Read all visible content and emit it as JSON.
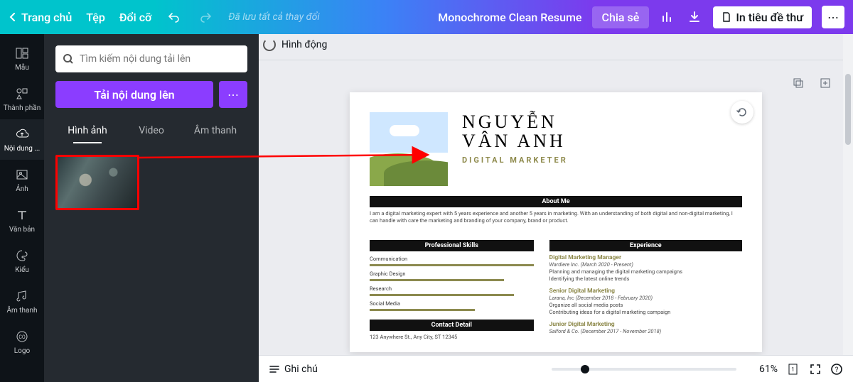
{
  "topbar": {
    "home": "Trang chủ",
    "file": "Tệp",
    "resize": "Đổi cỡ",
    "save_status": "Đã lưu tất cả thay đổi",
    "title": "Monochrome Clean Resume",
    "share": "Chia sẻ",
    "print": "In tiêu đề thư"
  },
  "rail": {
    "items": [
      {
        "label": "Mẫu"
      },
      {
        "label": "Thành phần"
      },
      {
        "label": "Nội dung ..."
      },
      {
        "label": "Ảnh"
      },
      {
        "label": "Văn bản"
      },
      {
        "label": "Kiểu"
      },
      {
        "label": "Âm thanh"
      },
      {
        "label": "Logo"
      }
    ]
  },
  "sidepanel": {
    "search_placeholder": "Tìm kiếm nội dung tải lên",
    "upload": "Tải nội dung lên",
    "tabs": [
      {
        "label": "Hình ảnh"
      },
      {
        "label": "Video"
      },
      {
        "label": "Âm thanh"
      }
    ]
  },
  "canvas": {
    "animate": "Hình động"
  },
  "resume": {
    "name_line1": "NGUYỄN",
    "name_line2": "VÂN ANH",
    "role": "DIGITAL MARKETER",
    "sec_about": "About Me",
    "about_text": "I am a digital marketing expert with 5 years experience and another 5 years in marketing. With an understanding of both digital and non-digital marketing, I can handle with care the marketing and branding of your company, brand or product.",
    "sec_skills": "Professional Skills",
    "sec_exp": "Experience",
    "skills": [
      "Communication",
      "Graphic Design",
      "Research",
      "Social Media"
    ],
    "sec_contact": "Contact Detail",
    "contact_addr": "123 Anywhere St., Any City, ST 12345",
    "jobs": [
      {
        "title": "Digital Marketing Manager",
        "meta": "Wardiere Inc. (March 2020 - Present)",
        "lines": [
          "Planning and managing the digital marketing campaigns",
          "Identifying the latest online trends"
        ]
      },
      {
        "title": "Senior Digital Marketing",
        "meta": "Larana, Inc (December 2018 - February 2020)",
        "lines": [
          "Organize all social media posts",
          "Contributing ideas for a digital marketing campaign"
        ]
      },
      {
        "title": "Junior Digital Marketing",
        "meta": "Salford & Co. (December 2017 - November 2018)"
      }
    ]
  },
  "bottom": {
    "notes": "Ghi chú",
    "zoom": "61%"
  }
}
